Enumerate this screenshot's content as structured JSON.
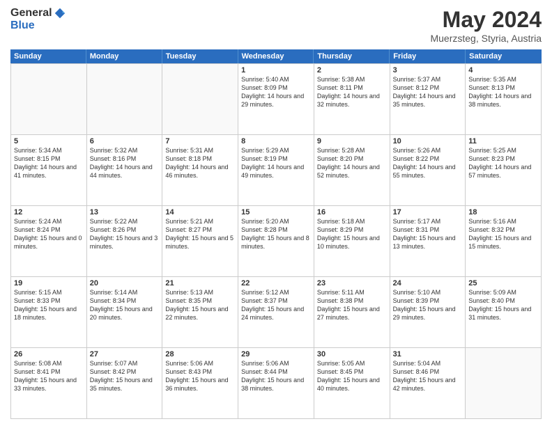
{
  "header": {
    "logo_general": "General",
    "logo_blue": "Blue",
    "main_title": "May 2024",
    "subtitle": "Muerzsteg, Styria, Austria"
  },
  "calendar": {
    "days_of_week": [
      "Sunday",
      "Monday",
      "Tuesday",
      "Wednesday",
      "Thursday",
      "Friday",
      "Saturday"
    ],
    "rows": [
      [
        {
          "day": "",
          "empty": true
        },
        {
          "day": "",
          "empty": true
        },
        {
          "day": "",
          "empty": true
        },
        {
          "day": "1",
          "sunrise": "5:40 AM",
          "sunset": "8:09 PM",
          "daylight": "14 hours and 29 minutes."
        },
        {
          "day": "2",
          "sunrise": "5:38 AM",
          "sunset": "8:11 PM",
          "daylight": "14 hours and 32 minutes."
        },
        {
          "day": "3",
          "sunrise": "5:37 AM",
          "sunset": "8:12 PM",
          "daylight": "14 hours and 35 minutes."
        },
        {
          "day": "4",
          "sunrise": "5:35 AM",
          "sunset": "8:13 PM",
          "daylight": "14 hours and 38 minutes."
        }
      ],
      [
        {
          "day": "5",
          "sunrise": "5:34 AM",
          "sunset": "8:15 PM",
          "daylight": "14 hours and 41 minutes."
        },
        {
          "day": "6",
          "sunrise": "5:32 AM",
          "sunset": "8:16 PM",
          "daylight": "14 hours and 44 minutes."
        },
        {
          "day": "7",
          "sunrise": "5:31 AM",
          "sunset": "8:18 PM",
          "daylight": "14 hours and 46 minutes."
        },
        {
          "day": "8",
          "sunrise": "5:29 AM",
          "sunset": "8:19 PM",
          "daylight": "14 hours and 49 minutes."
        },
        {
          "day": "9",
          "sunrise": "5:28 AM",
          "sunset": "8:20 PM",
          "daylight": "14 hours and 52 minutes."
        },
        {
          "day": "10",
          "sunrise": "5:26 AM",
          "sunset": "8:22 PM",
          "daylight": "14 hours and 55 minutes."
        },
        {
          "day": "11",
          "sunrise": "5:25 AM",
          "sunset": "8:23 PM",
          "daylight": "14 hours and 57 minutes."
        }
      ],
      [
        {
          "day": "12",
          "sunrise": "5:24 AM",
          "sunset": "8:24 PM",
          "daylight": "15 hours and 0 minutes."
        },
        {
          "day": "13",
          "sunrise": "5:22 AM",
          "sunset": "8:26 PM",
          "daylight": "15 hours and 3 minutes."
        },
        {
          "day": "14",
          "sunrise": "5:21 AM",
          "sunset": "8:27 PM",
          "daylight": "15 hours and 5 minutes."
        },
        {
          "day": "15",
          "sunrise": "5:20 AM",
          "sunset": "8:28 PM",
          "daylight": "15 hours and 8 minutes."
        },
        {
          "day": "16",
          "sunrise": "5:18 AM",
          "sunset": "8:29 PM",
          "daylight": "15 hours and 10 minutes."
        },
        {
          "day": "17",
          "sunrise": "5:17 AM",
          "sunset": "8:31 PM",
          "daylight": "15 hours and 13 minutes."
        },
        {
          "day": "18",
          "sunrise": "5:16 AM",
          "sunset": "8:32 PM",
          "daylight": "15 hours and 15 minutes."
        }
      ],
      [
        {
          "day": "19",
          "sunrise": "5:15 AM",
          "sunset": "8:33 PM",
          "daylight": "15 hours and 18 minutes."
        },
        {
          "day": "20",
          "sunrise": "5:14 AM",
          "sunset": "8:34 PM",
          "daylight": "15 hours and 20 minutes."
        },
        {
          "day": "21",
          "sunrise": "5:13 AM",
          "sunset": "8:35 PM",
          "daylight": "15 hours and 22 minutes."
        },
        {
          "day": "22",
          "sunrise": "5:12 AM",
          "sunset": "8:37 PM",
          "daylight": "15 hours and 24 minutes."
        },
        {
          "day": "23",
          "sunrise": "5:11 AM",
          "sunset": "8:38 PM",
          "daylight": "15 hours and 27 minutes."
        },
        {
          "day": "24",
          "sunrise": "5:10 AM",
          "sunset": "8:39 PM",
          "daylight": "15 hours and 29 minutes."
        },
        {
          "day": "25",
          "sunrise": "5:09 AM",
          "sunset": "8:40 PM",
          "daylight": "15 hours and 31 minutes."
        }
      ],
      [
        {
          "day": "26",
          "sunrise": "5:08 AM",
          "sunset": "8:41 PM",
          "daylight": "15 hours and 33 minutes."
        },
        {
          "day": "27",
          "sunrise": "5:07 AM",
          "sunset": "8:42 PM",
          "daylight": "15 hours and 35 minutes."
        },
        {
          "day": "28",
          "sunrise": "5:06 AM",
          "sunset": "8:43 PM",
          "daylight": "15 hours and 36 minutes."
        },
        {
          "day": "29",
          "sunrise": "5:06 AM",
          "sunset": "8:44 PM",
          "daylight": "15 hours and 38 minutes."
        },
        {
          "day": "30",
          "sunrise": "5:05 AM",
          "sunset": "8:45 PM",
          "daylight": "15 hours and 40 minutes."
        },
        {
          "day": "31",
          "sunrise": "5:04 AM",
          "sunset": "8:46 PM",
          "daylight": "15 hours and 42 minutes."
        },
        {
          "day": "",
          "empty": true
        }
      ]
    ]
  }
}
